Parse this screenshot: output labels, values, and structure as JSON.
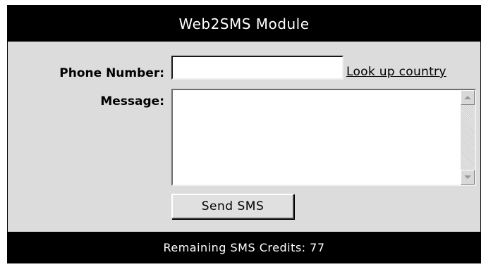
{
  "module": {
    "title": "Web2SMS Module",
    "phone_label": "Phone Number:",
    "phone_value": "",
    "lookup_link": "Look up country",
    "message_label": "Message:",
    "message_value": "",
    "send_label": "Send SMS",
    "footer_text": "Remaining SMS Credits: 77"
  },
  "colors": {
    "header_bg": "#000000",
    "panel_bg": "#dcdcdc",
    "text": "#000000",
    "header_text": "#ffffff"
  },
  "icons": {
    "scroll_up": "scroll-up-arrow-icon",
    "scroll_down": "scroll-down-arrow-icon"
  }
}
